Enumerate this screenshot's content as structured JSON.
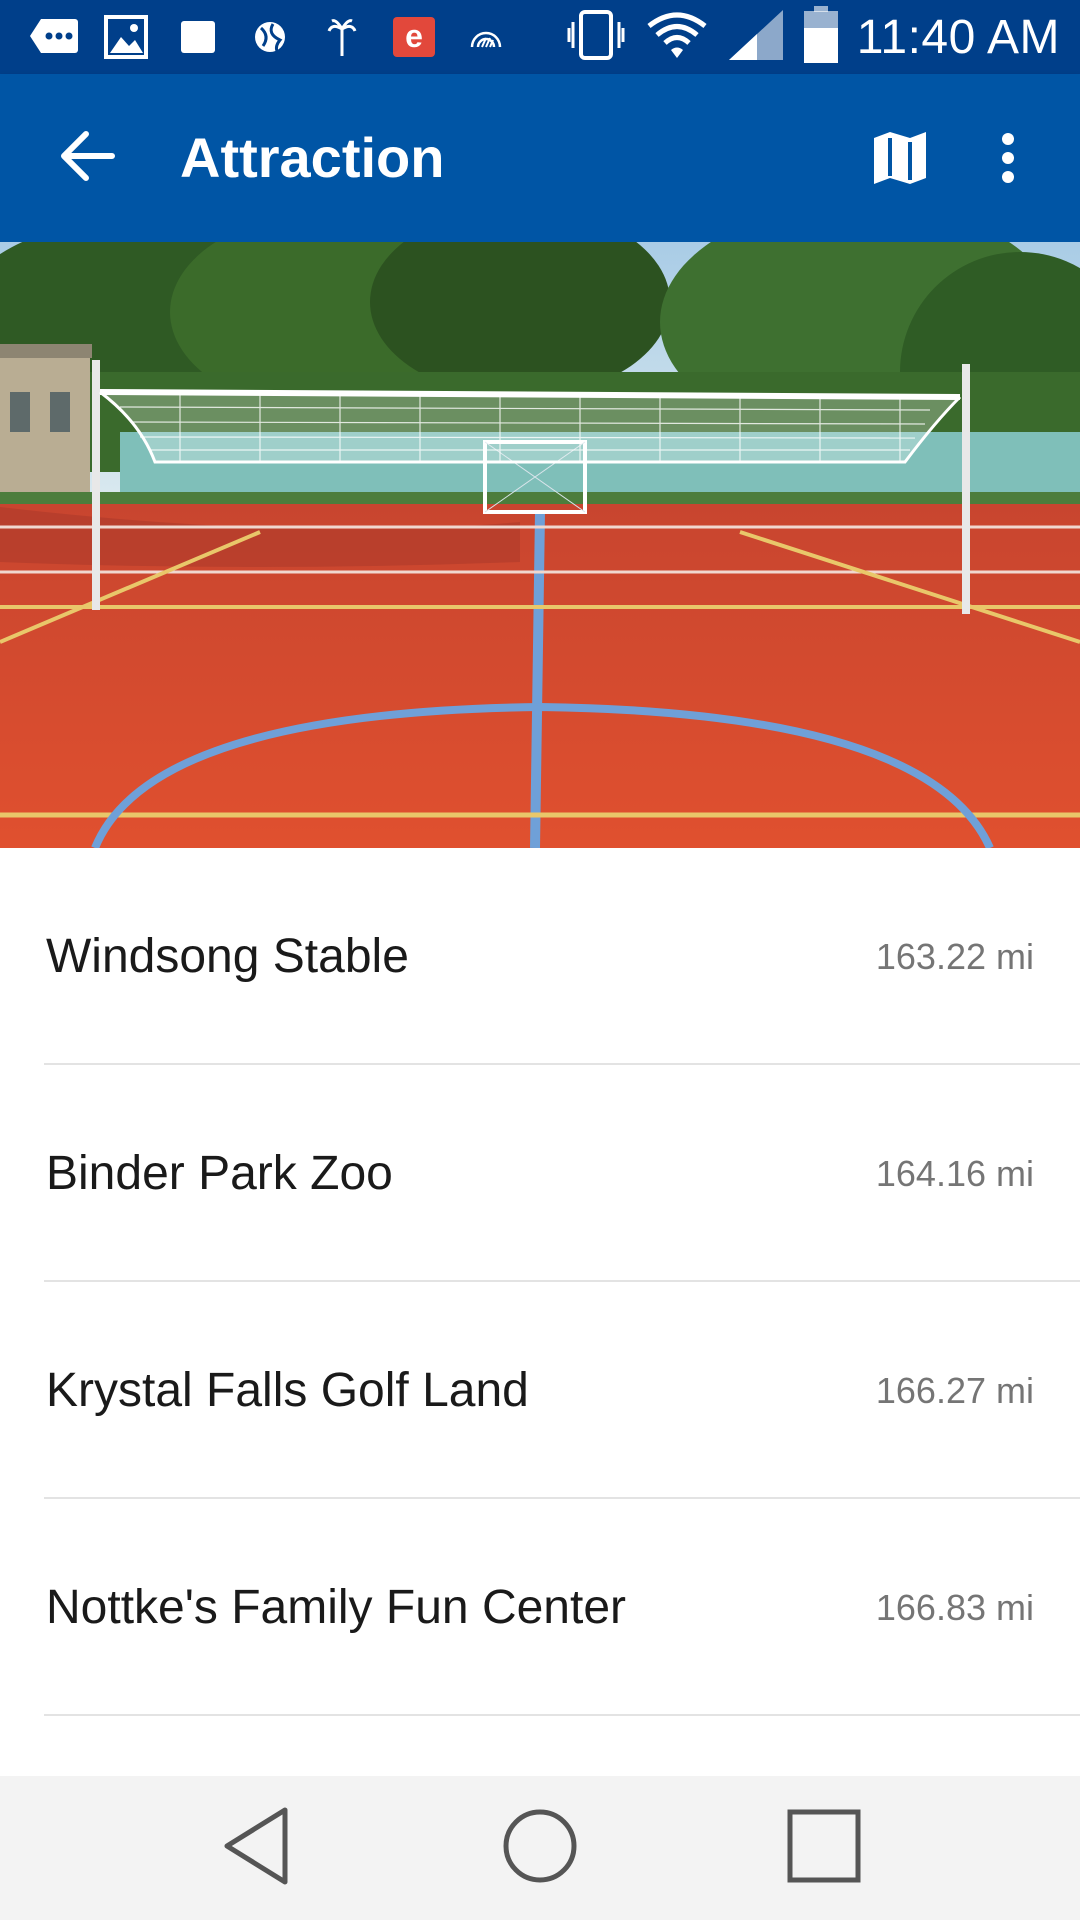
{
  "status_bar": {
    "time": "11:40 AM",
    "left_icons": [
      "message-icon",
      "image-icon",
      "square-app-icon",
      "globe-icon",
      "palm-tree-icon",
      "e-app-icon",
      "rainbow-icon"
    ],
    "right_icons": [
      "vibrate-icon",
      "wifi-icon",
      "signal-icon",
      "battery-icon"
    ],
    "e_app_letter": "e",
    "colors": {
      "background": "#003f8a",
      "e_app": "#e2483b"
    }
  },
  "app_bar": {
    "title": "Attraction",
    "back_icon": "arrow-back-icon",
    "map_icon": "map-icon",
    "more_icon": "more-vert-icon",
    "color": "#0055a5"
  },
  "hero": {
    "icon": "sports-court-photo"
  },
  "attractions": [
    {
      "name": "Windsong Stable",
      "distance": "163.22 mi"
    },
    {
      "name": "Binder Park Zoo",
      "distance": "164.16 mi"
    },
    {
      "name": "Krystal Falls Golf Land",
      "distance": "166.27 mi"
    },
    {
      "name": "Nottke's Family Fun Center",
      "distance": "166.83 mi"
    }
  ],
  "nav_bar": {
    "back_icon": "nav-back-icon",
    "home_icon": "nav-home-icon",
    "recents_icon": "nav-recents-icon"
  }
}
